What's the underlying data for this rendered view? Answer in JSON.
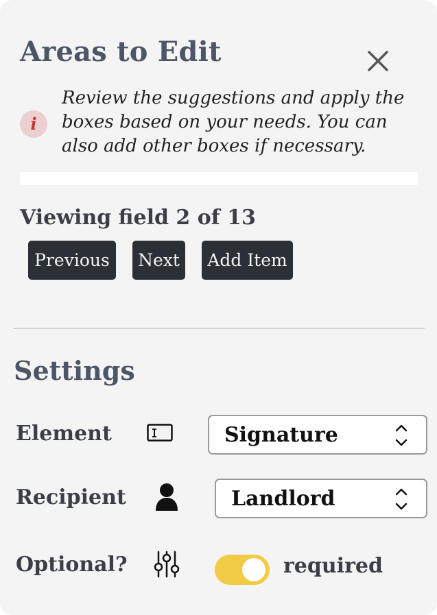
{
  "header": {
    "title": "Areas to Edit",
    "close_icon": "close-icon"
  },
  "info": {
    "icon_letter": "i",
    "text": "Review the suggestions and apply the boxes based on your needs. You can also add other boxes if necessary."
  },
  "navigation": {
    "viewing_text": "Viewing field 2 of 13",
    "previous_label": "Previous",
    "next_label": "Next",
    "add_item_label": "Add Item"
  },
  "settings": {
    "title": "Settings",
    "element": {
      "label": "Element",
      "icon": "text-field-icon",
      "value": "Signature"
    },
    "recipient": {
      "label": "Recipient",
      "icon": "person-icon",
      "value": "Landlord"
    },
    "optional": {
      "label": "Optional?",
      "icon": "sliders-icon",
      "toggle_on": true,
      "toggle_text": "required"
    }
  },
  "colors": {
    "button_bg": "#2b2f36",
    "toggle_accent": "#f0cb43",
    "info_icon_bg": "#eccfd0",
    "info_icon_fg": "#c6322e",
    "heading": "#4d5666"
  }
}
